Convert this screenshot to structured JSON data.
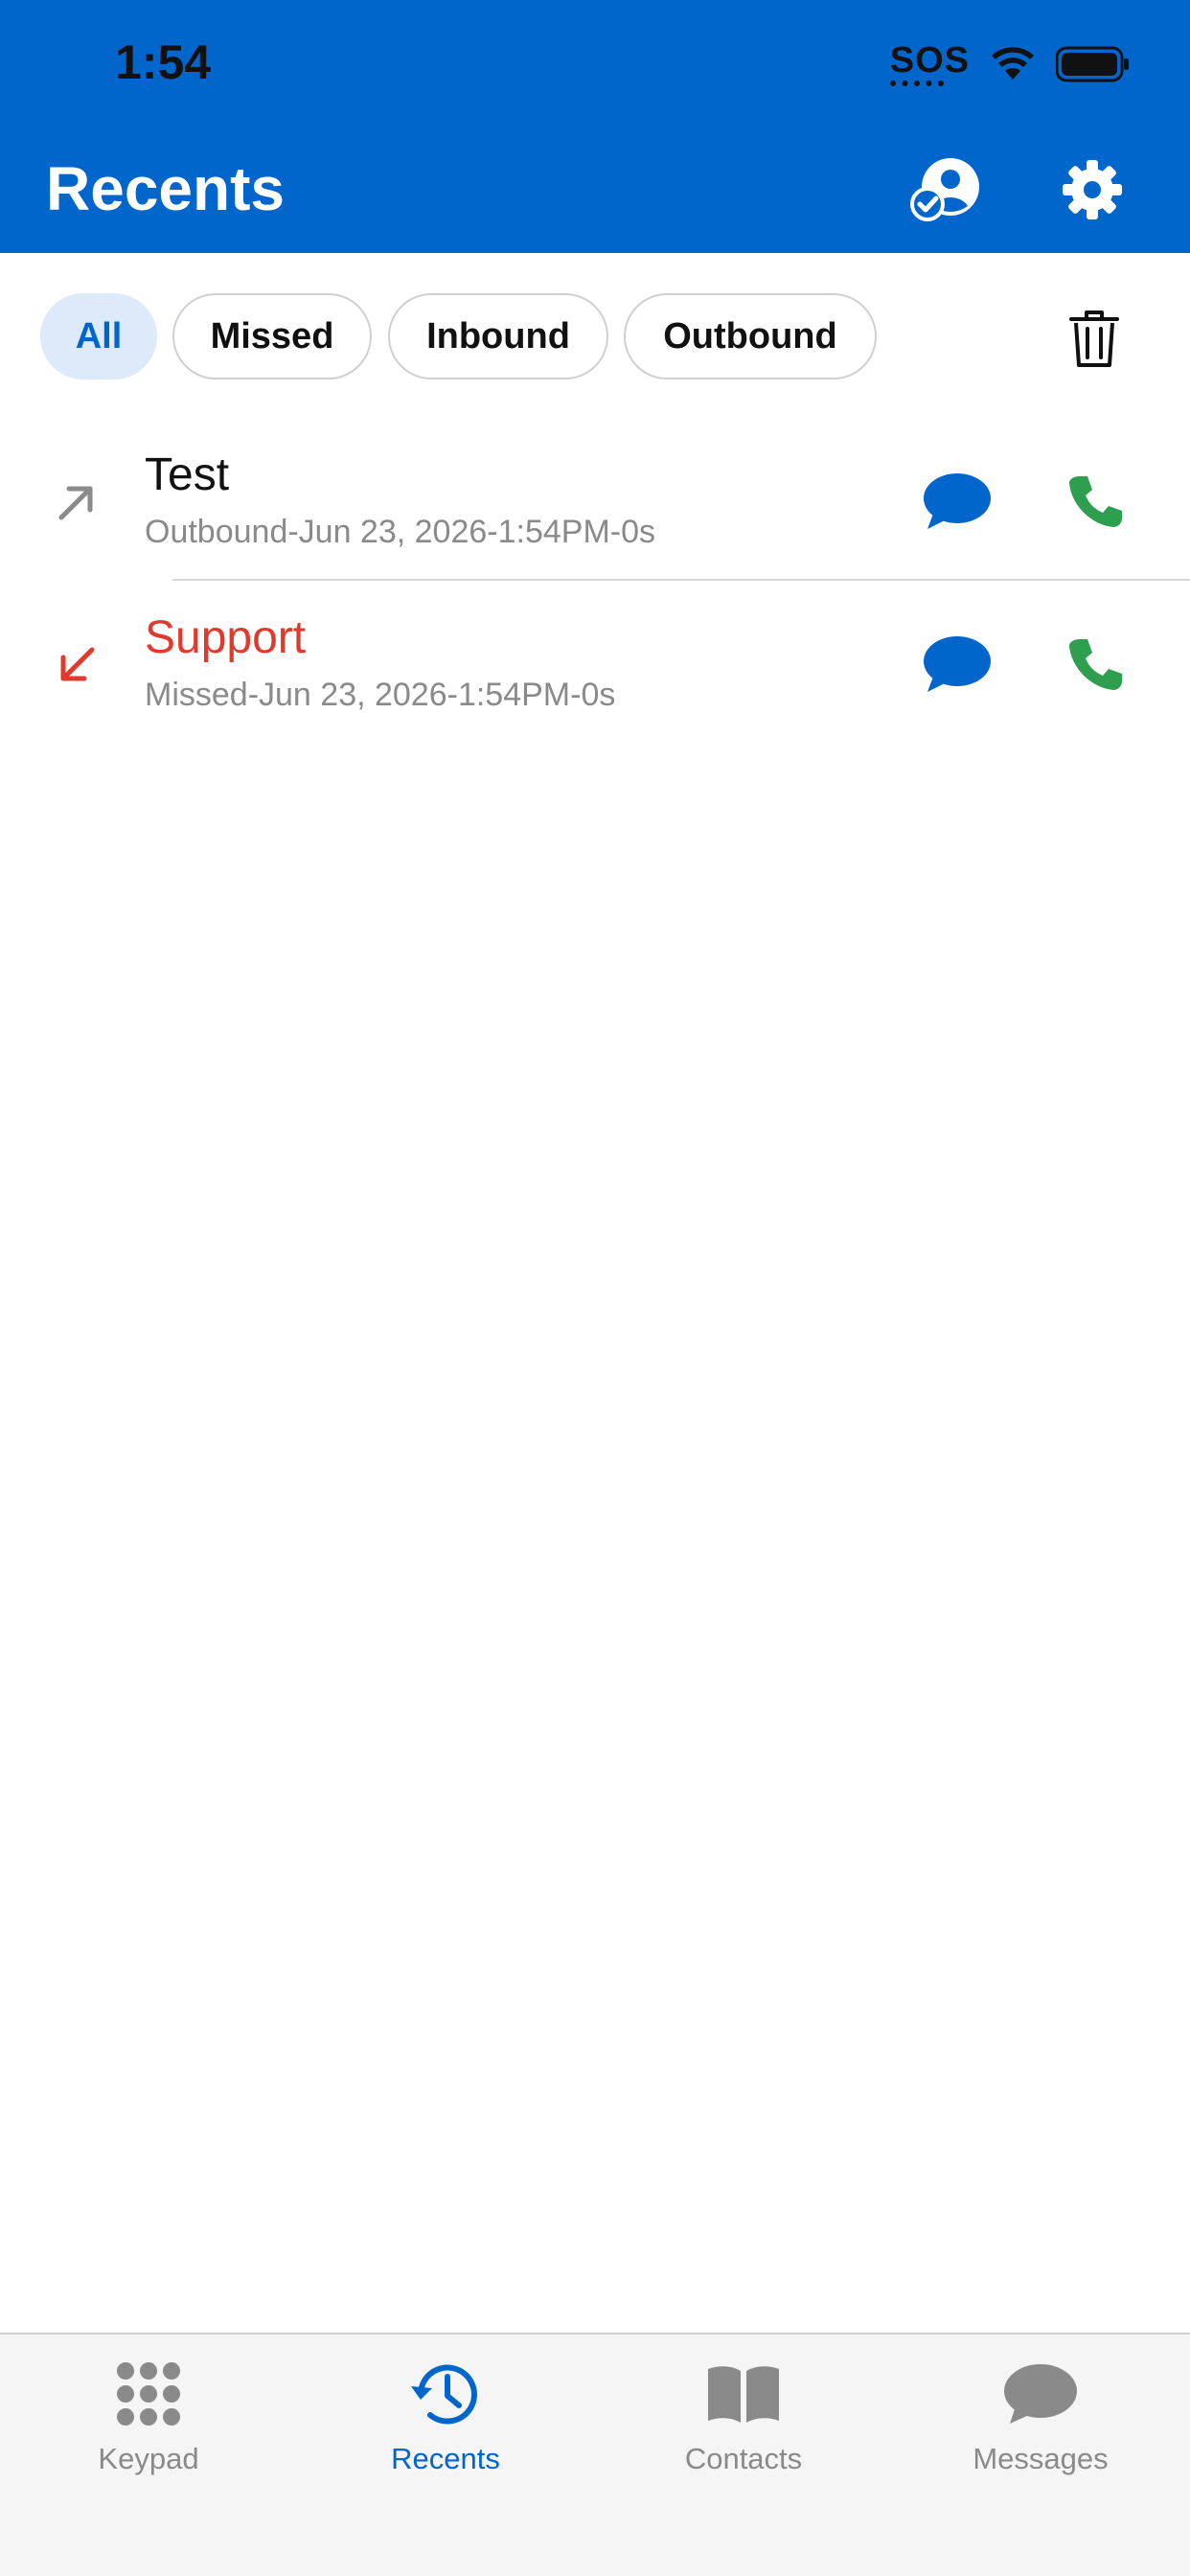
{
  "status_bar": {
    "time": "1:54",
    "sos": "SOS"
  },
  "header": {
    "title": "Recents"
  },
  "filters": [
    {
      "label": "All",
      "active": true
    },
    {
      "label": "Missed",
      "active": false
    },
    {
      "label": "Inbound",
      "active": false
    },
    {
      "label": "Outbound",
      "active": false
    }
  ],
  "calls": [
    {
      "name": "Test",
      "detail": "Outbound-Jun 23, 2026-1:54PM-0s",
      "direction": "outbound"
    },
    {
      "name": "Support",
      "detail": "Missed-Jun 23, 2026-1:54PM-0s",
      "direction": "missed"
    }
  ],
  "tabs": [
    {
      "label": "Keypad",
      "icon": "keypad-icon",
      "active": false
    },
    {
      "label": "Recents",
      "icon": "clock-history-icon",
      "active": true
    },
    {
      "label": "Contacts",
      "icon": "book-icon",
      "active": false
    },
    {
      "label": "Messages",
      "icon": "chat-bubble-icon",
      "active": false
    }
  ],
  "colors": {
    "brand": "#0066CC",
    "missed": "#E03A2F",
    "call_green": "#2E9E4F",
    "active_chip_bg": "#DCEAF9"
  }
}
